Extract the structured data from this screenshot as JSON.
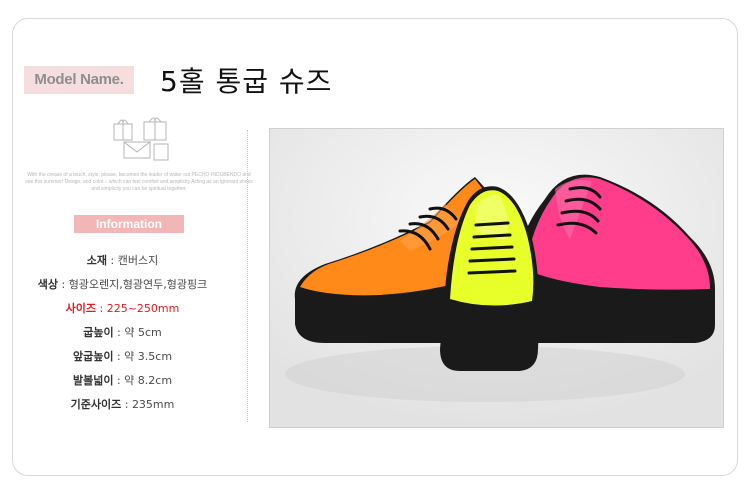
{
  "model_badge": "Model Name.",
  "title": "5홀 통굽 슈즈",
  "description": "With the crease of a touch, style, please, becomes the leader of water out PECHO-INDUBENDO and see this summer! Design, and color... which can feel comfort and simplicity Acting as an ignorant shoes and simplicity you can be spiritual together.",
  "info_badge": "Information",
  "specs": [
    {
      "label": "소재",
      "sep": " : ",
      "value": "캔버스지",
      "highlight": false
    },
    {
      "label": "색상",
      "sep": " : ",
      "value": "형광오렌지,형광연두,형광핑크",
      "highlight": false
    },
    {
      "label": "사이즈",
      "sep": " : ",
      "value": "225~250mm",
      "highlight": true
    },
    {
      "label": "굽높이",
      "sep": " : ",
      "value": "약 5cm",
      "highlight": false
    },
    {
      "label": "앞굽높이",
      "sep": " : ",
      "value": "약 3.5cm",
      "highlight": false
    },
    {
      "label": "발볼넓이",
      "sep": " : ",
      "value": "약 8.2cm",
      "highlight": false
    },
    {
      "label": "기준사이즈",
      "sep": " : ",
      "value": "235mm",
      "highlight": false
    }
  ],
  "colors": {
    "badge_bg": "#f6dede",
    "info_bg": "#f3b6b6",
    "highlight": "#e01b1b",
    "shoe_orange": "#ff8a1a",
    "shoe_yellow": "#e8ff2a",
    "shoe_pink": "#ff3d8a"
  }
}
